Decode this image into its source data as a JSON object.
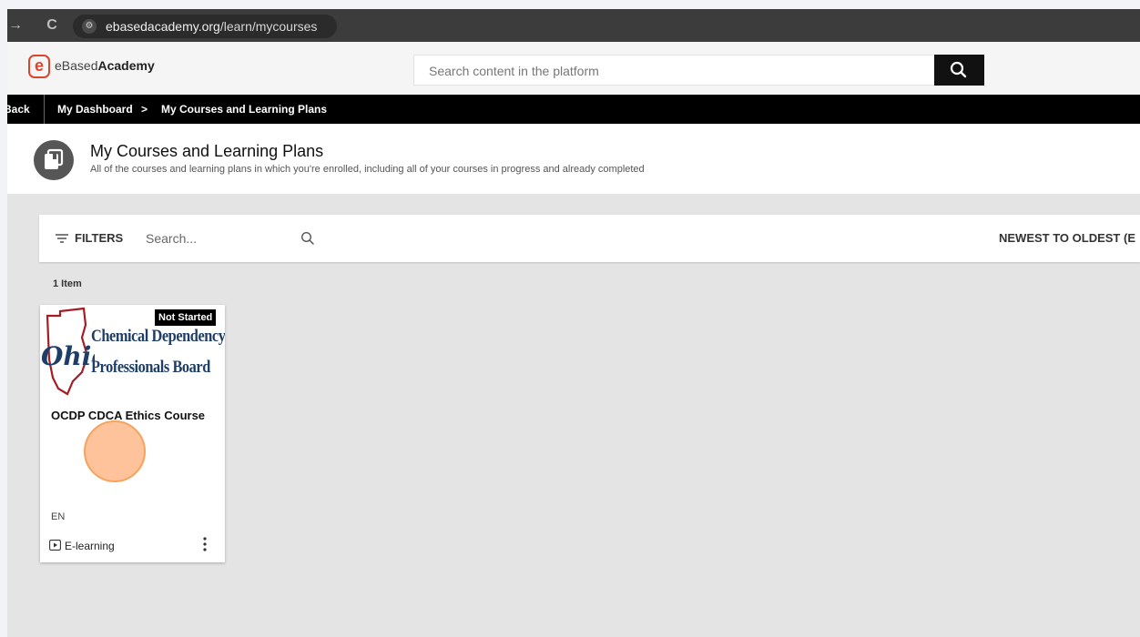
{
  "browser": {
    "url_host": "ebasedacademy.org",
    "url_path": "/learn/mycourses",
    "forward_glyph": "→",
    "reload_glyph": "C",
    "site_info_glyph": "⚙"
  },
  "header": {
    "logo_mark": "e",
    "logo_prefix": "eBased",
    "logo_bold": "Academy",
    "search_placeholder": "Search content in the platform"
  },
  "breadcrumb": {
    "back_label": "Back",
    "items": [
      "My Dashboard",
      "My Courses and Learning Plans"
    ],
    "separator": ">"
  },
  "page": {
    "title": "My Courses and Learning Plans",
    "description": "All of the courses and learning plans in which you're enrolled, including all of your courses in progress and already completed"
  },
  "filters": {
    "label": "FILTERS",
    "search_placeholder": "Search...",
    "sort_label": "NEWEST TO OLDEST (E"
  },
  "results": {
    "count_label": "1 Item"
  },
  "course": {
    "thumbnail_lines": [
      "Chemical Dependency",
      "Professionals Board"
    ],
    "status": "Not Started",
    "title": "OCDP CDCA Ethics Course",
    "language": "EN",
    "type": "E-learning"
  },
  "colors": {
    "brand": "#d9452d",
    "thumbnail_text": "#1f3e67",
    "click_marker": "#f5a35e"
  }
}
